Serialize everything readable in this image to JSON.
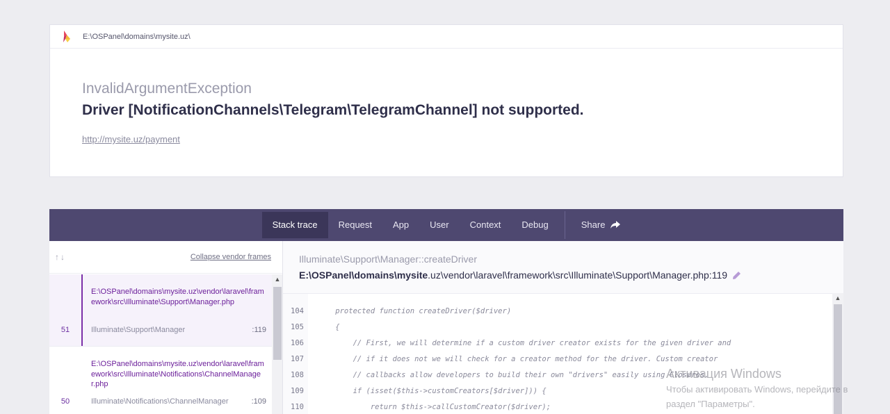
{
  "header": {
    "path": "E:\\OSPanel\\domains\\mysite.uz\\"
  },
  "exception": {
    "class": "InvalidArgumentException",
    "message": "Driver [NotificationChannels\\Telegram\\TelegramChannel] not supported.",
    "url": "http://mysite.uz/payment"
  },
  "tabs": {
    "stack_trace": "Stack trace",
    "request": "Request",
    "app": "App",
    "user": "User",
    "context": "Context",
    "debug": "Debug",
    "share": "Share",
    "active": "Stack trace"
  },
  "sidebar": {
    "arrows": "↑↓",
    "collapse_label": "Collapse vendor frames",
    "frames": [
      {
        "number": "51",
        "file": "E:\\OSPanel\\domains\\mysite.uz\\vendor\\laravel\\framework\\src\\Illuminate\\Support\\Manager.php",
        "class": "Illuminate\\Support\\Manager",
        "line": ":119"
      },
      {
        "number": "50",
        "file": "E:\\OSPanel\\domains\\mysite.uz\\vendor\\laravel\\framework\\src\\Illuminate\\Notifications\\ChannelManager.php",
        "class": "Illuminate\\Notifications\\ChannelManager",
        "line": ":109"
      }
    ]
  },
  "detail": {
    "class_method": "Illuminate\\Support\\Manager::createDriver",
    "file_prefix": "E:\\OSPanel\\domains\\mysite",
    "file_rest": ".uz\\vendor\\laravel\\framework\\src\\Illuminate\\Support\\Manager.php:119"
  },
  "code": [
    {
      "n": "104",
      "text": "    protected function createDriver($driver)"
    },
    {
      "n": "105",
      "text": "    {"
    },
    {
      "n": "106",
      "text": "        // First, we will determine if a custom driver creator exists for the given driver and"
    },
    {
      "n": "107",
      "text": "        // if it does not we will check for a creator method for the driver. Custom creator"
    },
    {
      "n": "108",
      "text": "        // callbacks allow developers to build their own \"drivers\" easily using Closures."
    },
    {
      "n": "109",
      "text": "        if (isset($this->customCreators[$driver])) {"
    },
    {
      "n": "110",
      "text": "            return $this->callCustomCreator($driver);"
    }
  ],
  "watermark": {
    "title": "Активация Windows",
    "line1": "Чтобы активировать Windows, перейдите в",
    "line2": "раздел \"Параметры\"."
  },
  "colors": {
    "tabs_bg": "#4e4870",
    "tab_active_bg": "#3b3659",
    "frame_accent": "#7b2fa8"
  }
}
